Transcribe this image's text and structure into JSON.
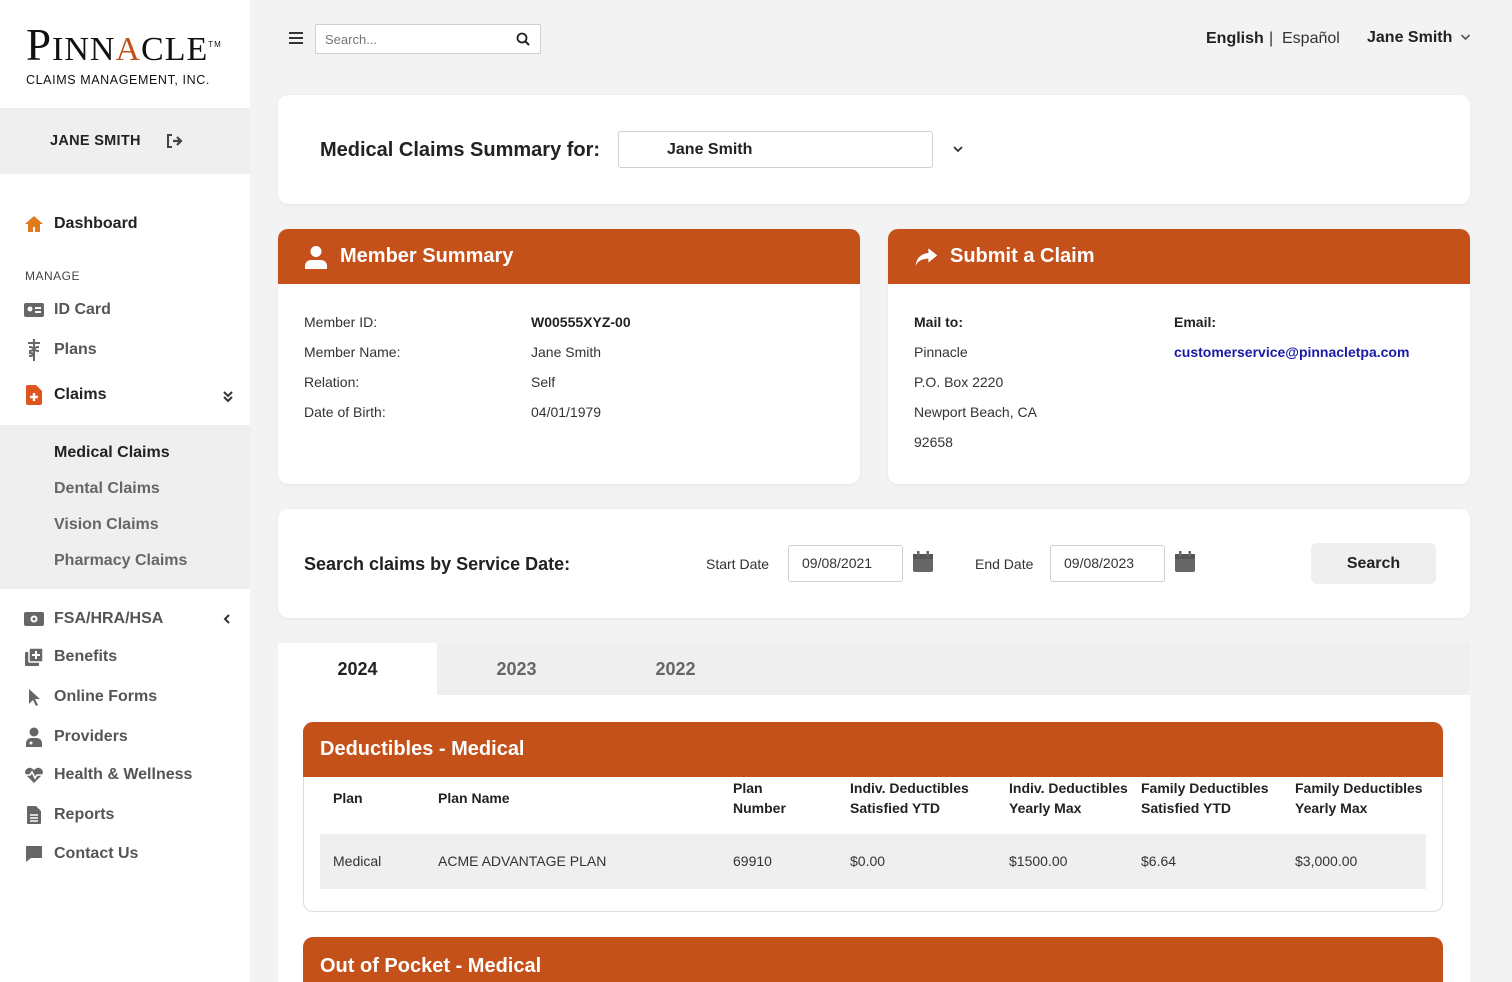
{
  "brand": {
    "logo_pre": "P",
    "logo_main_1": "INN",
    "logo_accent": "A",
    "logo_main_2": "CLE",
    "logo_tm": "TM",
    "logo_sub": "CLAIMS MANAGEMENT, INC.",
    "accent_color": "#c4501a"
  },
  "sidebar": {
    "user_name": "JANE SMITH",
    "dashboard": "Dashboard",
    "manage_label": "MANAGE",
    "items": {
      "id_card": "ID Card",
      "plans": "Plans",
      "claims": "Claims",
      "fsa": "FSA/HRA/HSA",
      "benefits": "Benefits",
      "online_forms": "Online Forms",
      "providers": "Providers",
      "health": "Health & Wellness",
      "reports": "Reports",
      "contact": "Contact Us"
    },
    "claims_sub": {
      "medical": "Medical Claims",
      "dental": "Dental Claims",
      "vision": "Vision Claims",
      "pharmacy": "Pharmacy Claims"
    }
  },
  "topbar": {
    "search_placeholder": "Search...",
    "lang_en": "English",
    "lang_sep": "|",
    "lang_es": "Español",
    "user": "Jane Smith"
  },
  "summary_for": {
    "label": "Medical Claims Summary for:",
    "selected": "Jane Smith"
  },
  "member_summary": {
    "title": "Member Summary",
    "rows": [
      {
        "label": "Member ID:",
        "value": "W00555XYZ-00"
      },
      {
        "label": "Member Name:",
        "value": "Jane Smith"
      },
      {
        "label": "Relation:",
        "value": "Self"
      },
      {
        "label": "Date of Birth:",
        "value": "04/01/1979"
      }
    ]
  },
  "submit_claim": {
    "title": "Submit a Claim",
    "mail_label": "Mail to:",
    "mail_lines": [
      "Pinnacle",
      "P.O. Box 2220",
      "Newport Beach, CA",
      "92658"
    ],
    "email_label": "Email:",
    "email": "customerservice@pinnacletpa.com"
  },
  "search_claims": {
    "label": "Search claims by Service Date:",
    "start_label": "Start Date",
    "start_value": "09/08/2021",
    "end_label": "End Date",
    "end_value": "09/08/2023",
    "button": "Search"
  },
  "tabs": [
    "2024",
    "2023",
    "2022"
  ],
  "deductibles": {
    "title": "Deductibles - Medical",
    "columns": [
      "Plan",
      "Plan Name",
      "Plan Number",
      "Indiv. Deductibles Satisfied YTD",
      "Indiv. Deductibles Yearly Max",
      "Family Deductibles Satisfied YTD",
      "Family Deductibles Yearly Max"
    ],
    "col_lines": [
      [
        "Plan",
        ""
      ],
      [
        "Plan Name",
        ""
      ],
      [
        "Plan",
        "Number"
      ],
      [
        "Indiv. Deductibles",
        "Satisfied YTD"
      ],
      [
        "Indiv. Deductibles",
        "Yearly Max"
      ],
      [
        "Family Deductibles",
        "Satisfied YTD"
      ],
      [
        "Family Deductibles",
        "Yearly Max"
      ]
    ],
    "rows": [
      [
        "Medical",
        "ACME ADVANTAGE PLAN",
        "69910",
        "$0.00",
        "$1500.00",
        "$6.64",
        "$3,000.00"
      ]
    ]
  },
  "out_of_pocket": {
    "title": "Out of Pocket - Medical"
  }
}
